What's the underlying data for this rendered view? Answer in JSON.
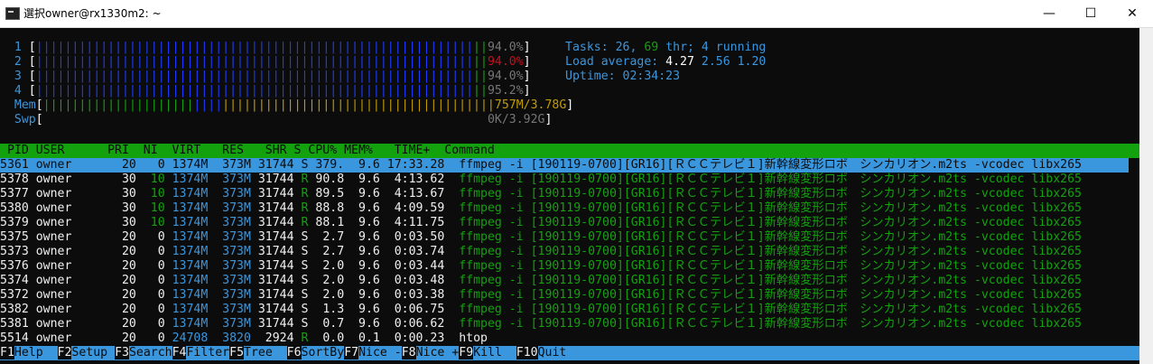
{
  "window": {
    "title": "選択owner@rx1330m2: ~",
    "minimize": "—",
    "maximize": "☐",
    "close": "✕"
  },
  "meters": {
    "cpu1_label": "1",
    "cpu1_val": "94.0%",
    "cpu2_label": "2",
    "cpu2_val": "94.0%",
    "cpu3_label": "3",
    "cpu3_val": "94.0%",
    "cpu4_label": "4",
    "cpu4_val": "95.2%",
    "mem_label": "Mem",
    "mem_val": "757M/3.78G",
    "swp_label": "Swp",
    "swp_val": "0K/3.92G"
  },
  "summary": {
    "tasks_label": "Tasks: ",
    "tasks": "26",
    "thr_sep": ", ",
    "thr": "69",
    "thr_label": " thr; ",
    "running": "4",
    "running_label": " running",
    "load_label": "Load average: ",
    "load1": "4.27",
    "load5": "2.56",
    "load15": "1.20",
    "uptime_label": "Uptime: ",
    "uptime": "02:34:23"
  },
  "columns": " PID USER      PRI  NI  VIRT   RES   SHR S CPU% MEM%   TIME+  Command",
  "processes": [
    {
      "pid": "5361",
      "user": "owner",
      "pri": "20",
      "ni": "0",
      "virt": "1374M",
      "res": "373M",
      "shr": "31744",
      "s": "S",
      "cpu": "379.",
      "mem": "9.6",
      "time": "17:33.28",
      "cmd": "ffmpeg -i [190119-0700][GR16][ＲＣＣテレビ１]新幹線変形ロボ　シンカリオン.m2ts -vcodec libx265"
    },
    {
      "pid": "5378",
      "user": "owner",
      "pri": "30",
      "ni": "10",
      "virt": "1374M",
      "res": "373M",
      "shr": "31744",
      "s": "R",
      "cpu": "90.8",
      "mem": "9.6",
      "time": "4:13.62",
      "cmd": "ffmpeg -i [190119-0700][GR16][ＲＣＣテレビ１]新幹線変形ロボ　シンカリオン.m2ts -vcodec libx265"
    },
    {
      "pid": "5377",
      "user": "owner",
      "pri": "30",
      "ni": "10",
      "virt": "1374M",
      "res": "373M",
      "shr": "31744",
      "s": "R",
      "cpu": "89.5",
      "mem": "9.6",
      "time": "4:13.67",
      "cmd": "ffmpeg -i [190119-0700][GR16][ＲＣＣテレビ１]新幹線変形ロボ　シンカリオン.m2ts -vcodec libx265"
    },
    {
      "pid": "5380",
      "user": "owner",
      "pri": "30",
      "ni": "10",
      "virt": "1374M",
      "res": "373M",
      "shr": "31744",
      "s": "R",
      "cpu": "88.8",
      "mem": "9.6",
      "time": "4:09.59",
      "cmd": "ffmpeg -i [190119-0700][GR16][ＲＣＣテレビ１]新幹線変形ロボ　シンカリオン.m2ts -vcodec libx265"
    },
    {
      "pid": "5379",
      "user": "owner",
      "pri": "30",
      "ni": "10",
      "virt": "1374M",
      "res": "373M",
      "shr": "31744",
      "s": "R",
      "cpu": "88.1",
      "mem": "9.6",
      "time": "4:11.75",
      "cmd": "ffmpeg -i [190119-0700][GR16][ＲＣＣテレビ１]新幹線変形ロボ　シンカリオン.m2ts -vcodec libx265"
    },
    {
      "pid": "5375",
      "user": "owner",
      "pri": "20",
      "ni": "0",
      "virt": "1374M",
      "res": "373M",
      "shr": "31744",
      "s": "S",
      "cpu": "2.7",
      "mem": "9.6",
      "time": "0:03.50",
      "cmd": "ffmpeg -i [190119-0700][GR16][ＲＣＣテレビ１]新幹線変形ロボ　シンカリオン.m2ts -vcodec libx265"
    },
    {
      "pid": "5373",
      "user": "owner",
      "pri": "20",
      "ni": "0",
      "virt": "1374M",
      "res": "373M",
      "shr": "31744",
      "s": "S",
      "cpu": "2.7",
      "mem": "9.6",
      "time": "0:03.74",
      "cmd": "ffmpeg -i [190119-0700][GR16][ＲＣＣテレビ１]新幹線変形ロボ　シンカリオン.m2ts -vcodec libx265"
    },
    {
      "pid": "5376",
      "user": "owner",
      "pri": "20",
      "ni": "0",
      "virt": "1374M",
      "res": "373M",
      "shr": "31744",
      "s": "S",
      "cpu": "2.0",
      "mem": "9.6",
      "time": "0:03.44",
      "cmd": "ffmpeg -i [190119-0700][GR16][ＲＣＣテレビ１]新幹線変形ロボ　シンカリオン.m2ts -vcodec libx265"
    },
    {
      "pid": "5374",
      "user": "owner",
      "pri": "20",
      "ni": "0",
      "virt": "1374M",
      "res": "373M",
      "shr": "31744",
      "s": "S",
      "cpu": "2.0",
      "mem": "9.6",
      "time": "0:03.48",
      "cmd": "ffmpeg -i [190119-0700][GR16][ＲＣＣテレビ１]新幹線変形ロボ　シンカリオン.m2ts -vcodec libx265"
    },
    {
      "pid": "5372",
      "user": "owner",
      "pri": "20",
      "ni": "0",
      "virt": "1374M",
      "res": "373M",
      "shr": "31744",
      "s": "S",
      "cpu": "2.0",
      "mem": "9.6",
      "time": "0:03.38",
      "cmd": "ffmpeg -i [190119-0700][GR16][ＲＣＣテレビ１]新幹線変形ロボ　シンカリオン.m2ts -vcodec libx265"
    },
    {
      "pid": "5382",
      "user": "owner",
      "pri": "20",
      "ni": "0",
      "virt": "1374M",
      "res": "373M",
      "shr": "31744",
      "s": "S",
      "cpu": "1.3",
      "mem": "9.6",
      "time": "0:06.75",
      "cmd": "ffmpeg -i [190119-0700][GR16][ＲＣＣテレビ１]新幹線変形ロボ　シンカリオン.m2ts -vcodec libx265"
    },
    {
      "pid": "5381",
      "user": "owner",
      "pri": "20",
      "ni": "0",
      "virt": "1374M",
      "res": "373M",
      "shr": "31744",
      "s": "S",
      "cpu": "0.7",
      "mem": "9.6",
      "time": "0:06.62",
      "cmd": "ffmpeg -i [190119-0700][GR16][ＲＣＣテレビ１]新幹線変形ロボ　シンカリオン.m2ts -vcodec libx265"
    },
    {
      "pid": "5514",
      "user": "owner",
      "pri": "20",
      "ni": "0",
      "virt": "24708",
      "res": "3820",
      "shr": "2924",
      "s": "R",
      "cpu": "0.0",
      "mem": "0.1",
      "time": "0:00.23",
      "cmd": "htop"
    }
  ],
  "footer": [
    {
      "key": "F1",
      "label": "Help  "
    },
    {
      "key": "F2",
      "label": "Setup "
    },
    {
      "key": "F3",
      "label": "Search"
    },
    {
      "key": "F4",
      "label": "Filter"
    },
    {
      "key": "F5",
      "label": "Tree  "
    },
    {
      "key": "F6",
      "label": "SortBy"
    },
    {
      "key": "F7",
      "label": "Nice -"
    },
    {
      "key": "F8",
      "label": "Nice +"
    },
    {
      "key": "F9",
      "label": "Kill  "
    },
    {
      "key": "F10",
      "label": "Quit"
    }
  ],
  "colors": {
    "cyan": "#3a96dd",
    "green": "#13a10e",
    "blue": "#1e3cff",
    "red": "#c50f1f",
    "yellow": "#c19c00"
  }
}
